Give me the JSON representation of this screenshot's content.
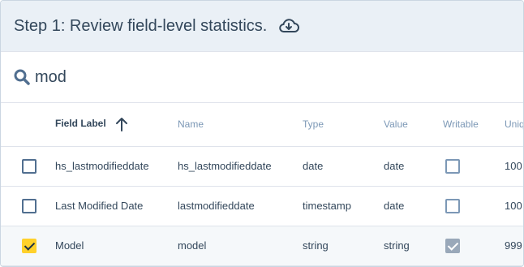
{
  "header": {
    "title": "Step 1: Review field-level statistics.",
    "download_icon": "cloud-download-icon"
  },
  "search": {
    "icon": "search-icon",
    "value": "mod"
  },
  "table": {
    "columns": [
      "Field Label",
      "Name",
      "Type",
      "Value",
      "Writable",
      "Uniq"
    ],
    "sort_icon": "arrow-up-icon",
    "rows": [
      {
        "selected": false,
        "field_label": "hs_lastmodifieddate",
        "name": "hs_lastmodifieddate",
        "type": "date",
        "value": "date",
        "writable": false,
        "uniq": "100"
      },
      {
        "selected": false,
        "field_label": "Last Modified Date",
        "name": "lastmodifieddate",
        "type": "timestamp",
        "value": "date",
        "writable": false,
        "uniq": "100"
      },
      {
        "selected": true,
        "field_label": "Model",
        "name": "model",
        "type": "string",
        "value": "string",
        "writable": true,
        "uniq": "999"
      }
    ]
  },
  "colors": {
    "header_bg": "#eaf0f6",
    "checkbox_selected": "#ffd12b",
    "text": "#33475b",
    "muted_header": "#7c98b6"
  }
}
